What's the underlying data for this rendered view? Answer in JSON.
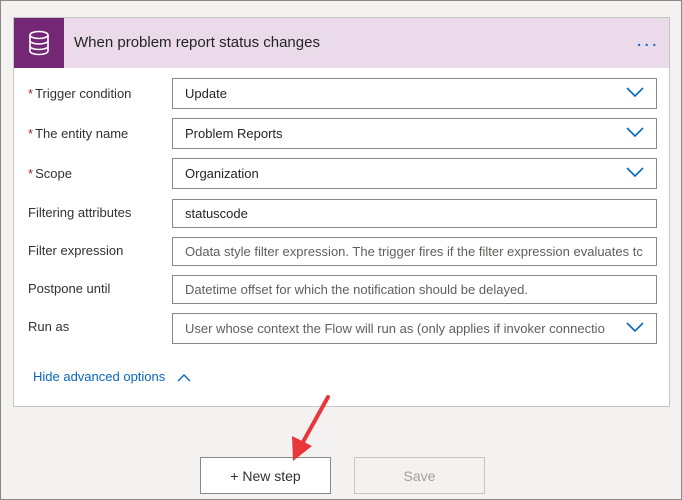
{
  "card": {
    "title": "When problem report status changes",
    "icon": "database-icon",
    "more_label": "..."
  },
  "fields": [
    {
      "label": "Trigger condition",
      "required": true,
      "value": "Update",
      "type": "dropdown"
    },
    {
      "label": "The entity name",
      "required": true,
      "value": "Problem Reports",
      "type": "dropdown"
    },
    {
      "label": "Scope",
      "required": true,
      "value": "Organization",
      "type": "dropdown"
    },
    {
      "label": "Filtering attributes",
      "required": false,
      "value": "statuscode",
      "type": "text"
    },
    {
      "label": "Filter expression",
      "required": false,
      "placeholder": "Odata style filter expression. The trigger fires if the filter expression evaluates tc",
      "type": "text"
    },
    {
      "label": "Postpone until",
      "required": false,
      "placeholder": "Datetime offset for which the notification should be delayed.",
      "type": "text"
    },
    {
      "label": "Run as",
      "required": false,
      "placeholder": "User whose context the Flow will run as (only applies if invoker connectio",
      "type": "dropdown"
    }
  ],
  "advanced_link": "Hide advanced options",
  "buttons": {
    "new_step": "+ New step",
    "save": "Save"
  },
  "colors": {
    "header_bg": "#eadaea",
    "icon_bg": "#742774",
    "link": "#0a66c2",
    "required": "#a4262c",
    "annotation_arrow": "#e8363a"
  }
}
